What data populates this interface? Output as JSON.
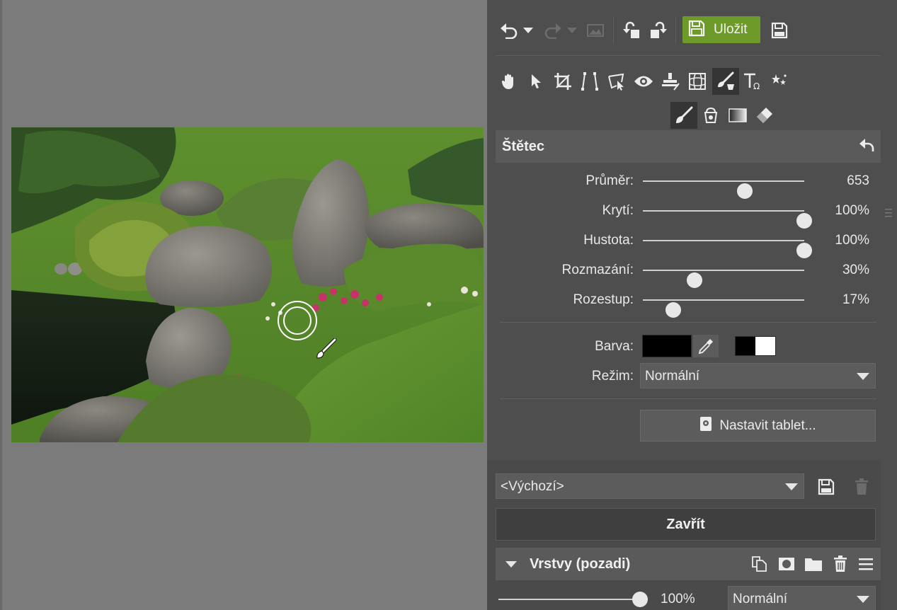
{
  "toolbar": {
    "save_label": "Uložit"
  },
  "brush": {
    "title": "Štětec",
    "sliders": [
      {
        "label": "Průměr:",
        "value": "653",
        "fraction": 0.63
      },
      {
        "label": "Krytí:",
        "value": "100%",
        "fraction": 1.0
      },
      {
        "label": "Hustota:",
        "value": "100%",
        "fraction": 1.0
      },
      {
        "label": "Rozmazání:",
        "value": "30%",
        "fraction": 0.32
      },
      {
        "label": "Rozestup:",
        "value": "17%",
        "fraction": 0.19
      }
    ],
    "color_label": "Barva:",
    "color_value": "#000000",
    "mode_label": "Režim:",
    "mode_value": "Normální",
    "tablet_label": "Nastavit tablet..."
  },
  "preset": {
    "value": "<Výchozí>"
  },
  "close_label": "Zavřít",
  "layers": {
    "title": "Vrstvy (pozadi)",
    "opacity_value": "100%",
    "opacity_fraction": 1.0,
    "blend_value": "Normální"
  },
  "colors": {
    "accent_save": "#6e9a2a",
    "panel_bg": "#4e4e4e",
    "canvas_bg": "#7b7b7b"
  }
}
